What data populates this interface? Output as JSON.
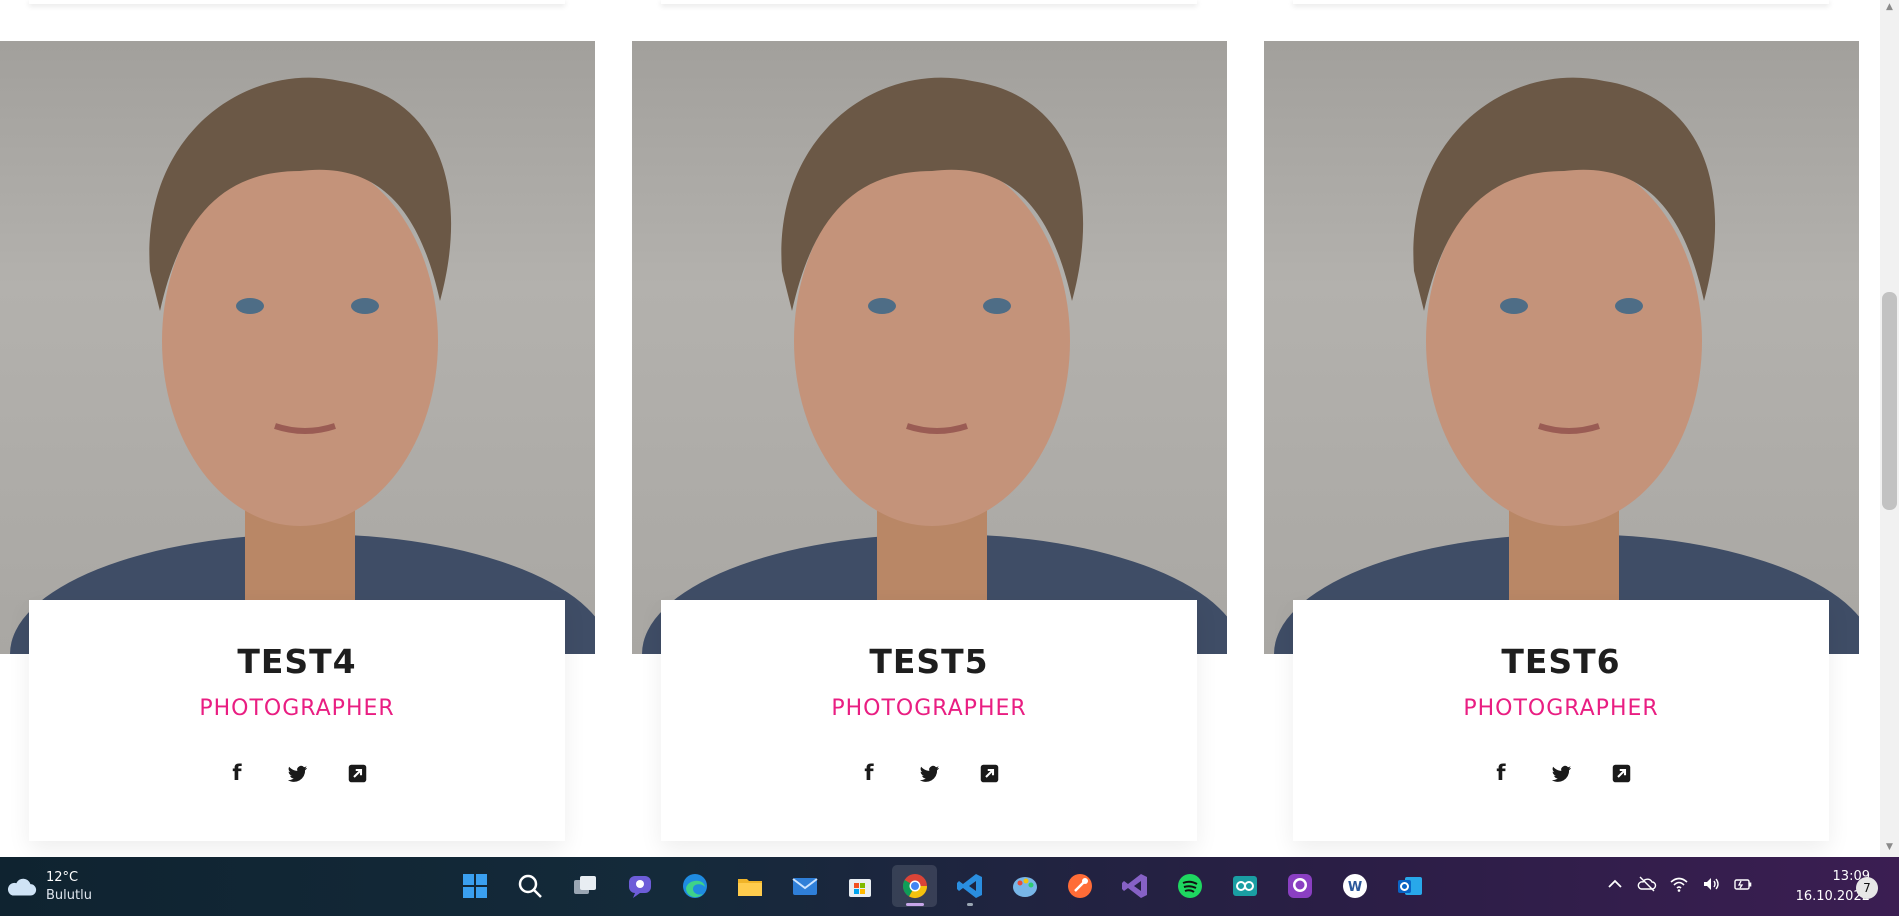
{
  "team": [
    {
      "name": "TEST4",
      "role": "PHOTOGRAPHER"
    },
    {
      "name": "TEST5",
      "role": "PHOTOGRAPHER"
    },
    {
      "name": "TEST6",
      "role": "PHOTOGRAPHER"
    }
  ],
  "social_icons": [
    "facebook-icon",
    "twitter-icon",
    "external-link-icon"
  ],
  "colors": {
    "accent": "#e91e82",
    "name": "#1e1e1e",
    "photo_bg": "#a6a4a0"
  },
  "taskbar": {
    "weather": {
      "temp": "12°C",
      "condition": "Bulutlu"
    },
    "apps": [
      "windows-start-icon",
      "search-icon",
      "task-view-icon",
      "chat-icon",
      "edge-icon",
      "file-explorer-icon",
      "mail-icon",
      "store-icon",
      "chrome-icon",
      "vscode-icon",
      "paint-icon",
      "postman-icon",
      "visual-studio-icon",
      "spotify-icon",
      "arduino-icon",
      "github-desktop-icon",
      "word-icon",
      "outlook-icon"
    ],
    "clock": {
      "time": "13:09",
      "date": "16.10.2022"
    },
    "notifications": "7"
  }
}
